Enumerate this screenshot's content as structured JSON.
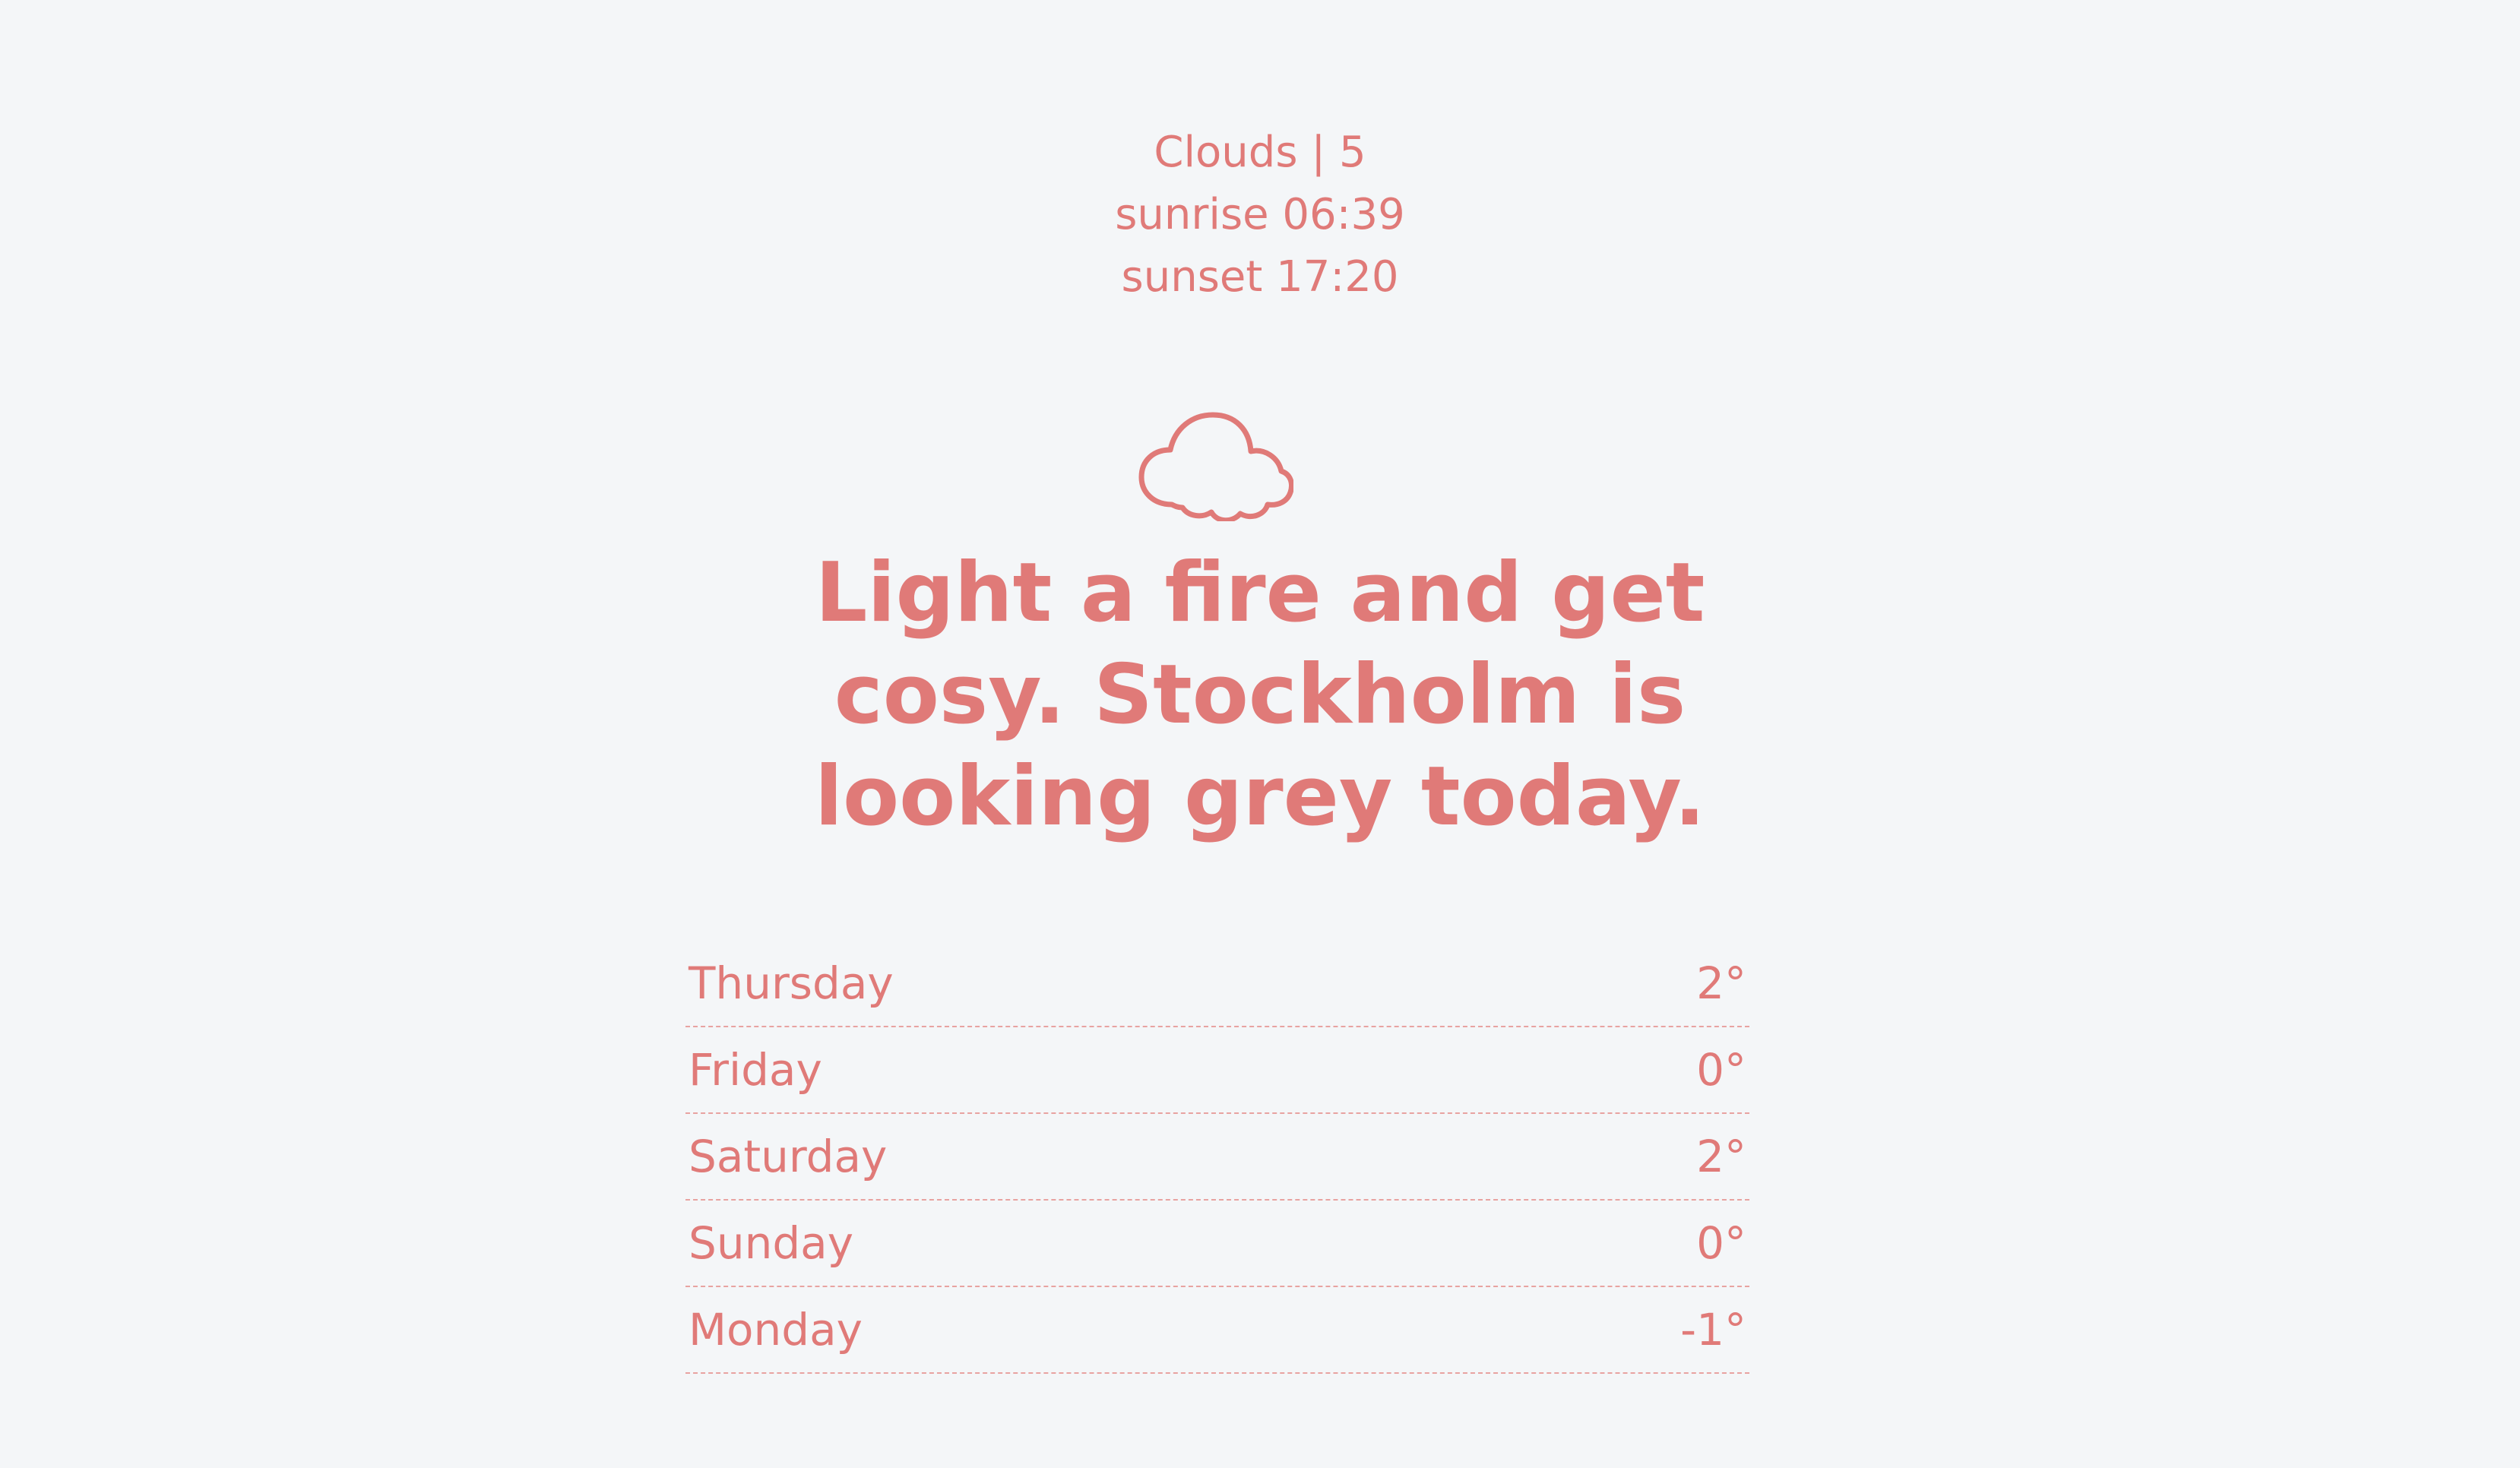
{
  "summary": {
    "condition_line": "Clouds | 5",
    "sunrise_line": "sunrise 06:39",
    "sunset_line": "sunset 17:20"
  },
  "icon": {
    "name": "cloud-icon",
    "color": "#e07a78"
  },
  "headline": "Light a fire and get cosy. Stockholm is looking grey today.",
  "forecast": [
    {
      "day": "Thursday",
      "temp": "2°"
    },
    {
      "day": "Friday",
      "temp": "0°"
    },
    {
      "day": "Saturday",
      "temp": "2°"
    },
    {
      "day": "Sunday",
      "temp": "0°"
    },
    {
      "day": "Monday",
      "temp": "-1°"
    }
  ],
  "colors": {
    "background": "#f4f6f8",
    "accent": "#e07a78"
  }
}
